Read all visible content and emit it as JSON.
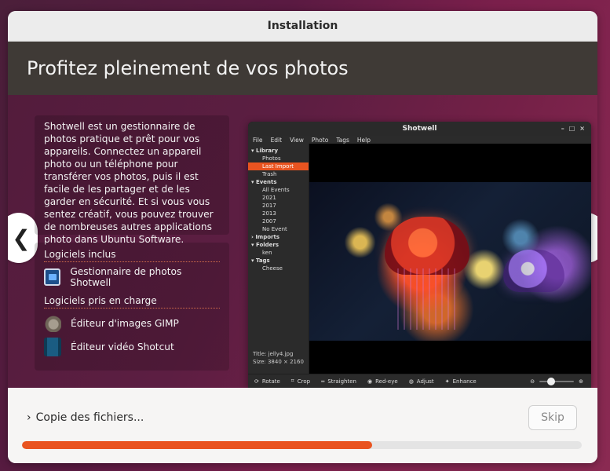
{
  "window": {
    "title": "Installation"
  },
  "slide": {
    "heading": "Profitez pleinement de vos photos",
    "description": "Shotwell est un gestionnaire de photos pratique et prêt pour vos appareils. Connectez un appareil photo ou un téléphone pour transférer vos photos, puis il est facile de les partager et de les garder en sécurité. Et si vous vous sentez créatif, vous pouvez trouver de nombreuses autres applications photo dans Ubuntu Software.",
    "included_title": "Logiciels inclus",
    "included_items": [
      {
        "label": "Gestionnaire de photos Shotwell",
        "icon": "shotwell-icon"
      }
    ],
    "supported_title": "Logiciels pris en charge",
    "supported_items": [
      {
        "label": "Éditeur d'images GIMP",
        "icon": "gimp-icon"
      },
      {
        "label": "Éditeur vidéo Shotcut",
        "icon": "shotcut-icon"
      }
    ],
    "nav": {
      "prev": "❮",
      "next": "❯"
    }
  },
  "shotwell": {
    "title": "Shotwell",
    "window_controls": [
      "–",
      "□",
      "×"
    ],
    "menu": [
      "File",
      "Edit",
      "View",
      "Photo",
      "Tags",
      "Help"
    ],
    "sidebar": {
      "library": "Library",
      "photos": "Photos",
      "last_import": "Last Import",
      "trash": "Trash",
      "events": "Events",
      "all_events": "All Events",
      "years": [
        "2021",
        "2017",
        "2013",
        "2007"
      ],
      "no_event": "No Event",
      "imports": "Imports",
      "folders": "Folders",
      "folder_ken": "ken",
      "tags": "Tags",
      "tag_cheese": "Cheese"
    },
    "meta": {
      "title_label": "Title:",
      "title_value": "jelly4.jpg",
      "size_label": "Size:",
      "size_value": "3840 × 2160"
    },
    "toolbar": {
      "rotate": "Rotate",
      "crop": "Crop",
      "straighten": "Straighten",
      "red_eye": "Red-eye",
      "adjust": "Adjust",
      "enhance": "Enhance",
      "zoom_out": "⊖",
      "zoom_in": "⊕"
    }
  },
  "footer": {
    "chevron": "›",
    "status": "Copie des fichiers...",
    "skip_label": "Skip",
    "progress_fraction": 0.625
  },
  "colors": {
    "accent": "#e95420",
    "header_bg": "#3f3a36",
    "slide_bg": "#5c1e42"
  }
}
